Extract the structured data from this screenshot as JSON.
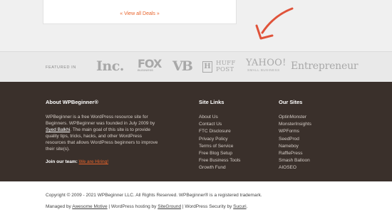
{
  "deals": {
    "view_all": "« View all Deals »"
  },
  "featured": {
    "label": "FEATURED IN",
    "logos": {
      "inc": "Inc.",
      "fox": "FOX",
      "fox_sub": "BUSINESS",
      "vb": "VB",
      "huff_mark": "H",
      "huff_line1": "HUFF",
      "huff_line2": "POST",
      "yahoo": "YAHOO!",
      "yahoo_sub": "SMALL BUSINESS",
      "entrepreneur": "Entrepreneur"
    }
  },
  "about": {
    "title": "About WPBeginner®",
    "text_before": "WPBeginner is a free WordPress resource site for Beginners. WPBeginner was founded in July 2009 by ",
    "founder": "Syed Balkhi",
    "text_after": ". The main goal of this site is to provide quality tips, tricks, hacks, and other WordPress resources that allows WordPress beginners to improve their site(s).",
    "team_label": "Join our team:",
    "hiring_link": "We are Hiring!"
  },
  "site_links": {
    "title": "Site Links",
    "items": [
      "About Us",
      "Contact Us",
      "FTC Disclosure",
      "Privacy Policy",
      "Terms of Service",
      "Free Blog Setup",
      "Free Business Tools",
      "Growth Fund"
    ]
  },
  "our_sites": {
    "title": "Our Sites",
    "items": [
      "OptinMonster",
      "MonsterInsights",
      "WPForms",
      "SeedProd",
      "Nameboy",
      "RafflePress",
      "Smash Balloon",
      "AIOSEO"
    ]
  },
  "bottom": {
    "copyright": "Copyright © 2009 - 2021 WPBeginner LLC. All Rights Reserved. WPBeginner® is a registered trademark.",
    "managed_prefix": "Managed by ",
    "managed_link": "Awesome Motive",
    "hosting_prefix": " | WordPress hosting by ",
    "hosting_link": "SiteGround",
    "security_prefix": " | WordPress Security by ",
    "security_link": "Sucuri",
    "end": "."
  },
  "colors": {
    "accent": "#e8632b",
    "footer_bg": "#3a302b",
    "arrow": "#e0533a"
  }
}
